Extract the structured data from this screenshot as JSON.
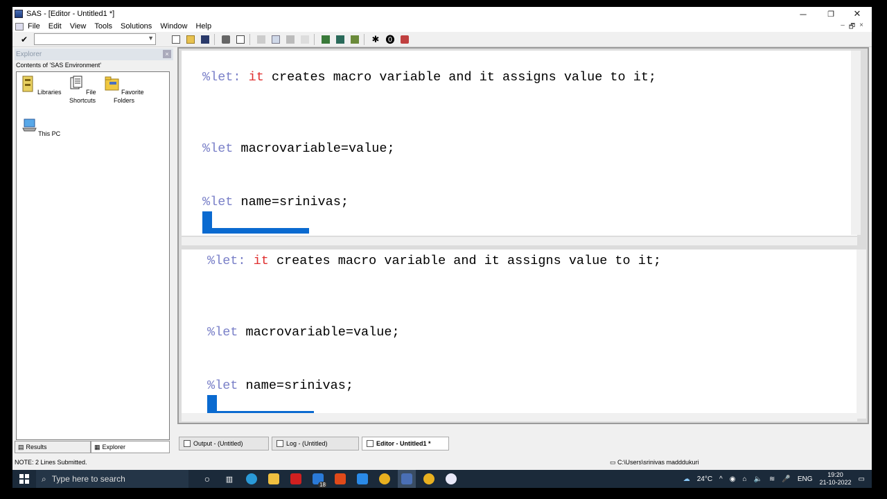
{
  "window": {
    "title": "SAS - [Editor - Untitled1 *]",
    "controls": [
      "─",
      "❐",
      "✕"
    ]
  },
  "menu": [
    "File",
    "Edit",
    "View",
    "Tools",
    "Solutions",
    "Window",
    "Help"
  ],
  "explorer": {
    "header": "Explorer",
    "contents_label": "Contents of 'SAS Environment'",
    "items": [
      "Libraries",
      "File Shortcuts",
      "Favorite Folders",
      "This PC"
    ],
    "tabs": [
      "Results",
      "Explorer"
    ]
  },
  "editor": {
    "lines": [
      {
        "kw": "%let:",
        "rest_red": "it",
        "rest": " creates macro variable and it assigns value to it;"
      },
      {
        "kw": "%let",
        "rest": " macrovariable=value;"
      },
      {
        "kw": "%let",
        "rest": " name=srinivas;"
      }
    ]
  },
  "window_tabs": [
    "Output - (Untitled)",
    "Log - (Untitled)",
    "Editor - Untitled1 *"
  ],
  "status": {
    "note": "NOTE: 2 Lines Submitted.",
    "path": "C:\\Users\\srinivas madddukuri"
  },
  "taskbar": {
    "search_placeholder": "Type here to search",
    "mail_badge": "18",
    "weather": "24°C",
    "lang": "ENG",
    "time": "19:20",
    "date": "21-10-2022"
  }
}
